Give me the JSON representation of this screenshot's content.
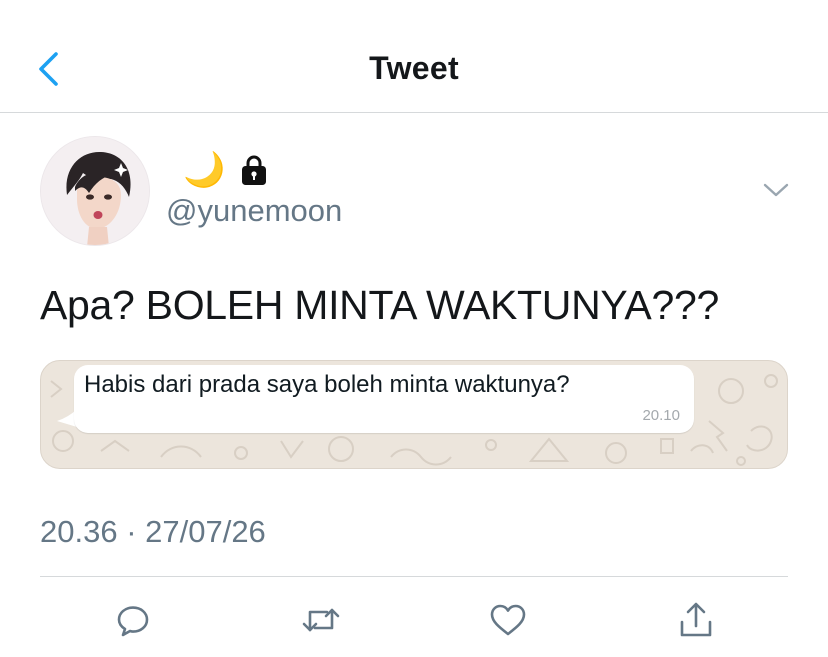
{
  "header": {
    "title": "Tweet",
    "back_icon": "chevron-left-icon",
    "accent_color": "#1da1f2"
  },
  "author": {
    "display_name_emoji": "🌙",
    "protected_icon": "lock-icon",
    "handle": "@yunemoon",
    "menu_icon": "chevron-down-icon"
  },
  "tweet": {
    "text": "Apa? BOLEH MINTA WAKTUNYA???",
    "media": {
      "message_text": "Habis dari prada saya boleh minta waktunya?",
      "message_time": "20.10"
    },
    "timestamp": "20.36 · 27/07/26"
  },
  "actions": [
    {
      "name": "reply",
      "icon": "reply-icon"
    },
    {
      "name": "retweet",
      "icon": "retweet-icon"
    },
    {
      "name": "like",
      "icon": "heart-icon"
    },
    {
      "name": "share",
      "icon": "share-icon"
    }
  ],
  "colors": {
    "text_primary": "#14171a",
    "text_secondary": "#657786",
    "icon_gray": "#657786",
    "chat_background": "#ece5dc"
  }
}
